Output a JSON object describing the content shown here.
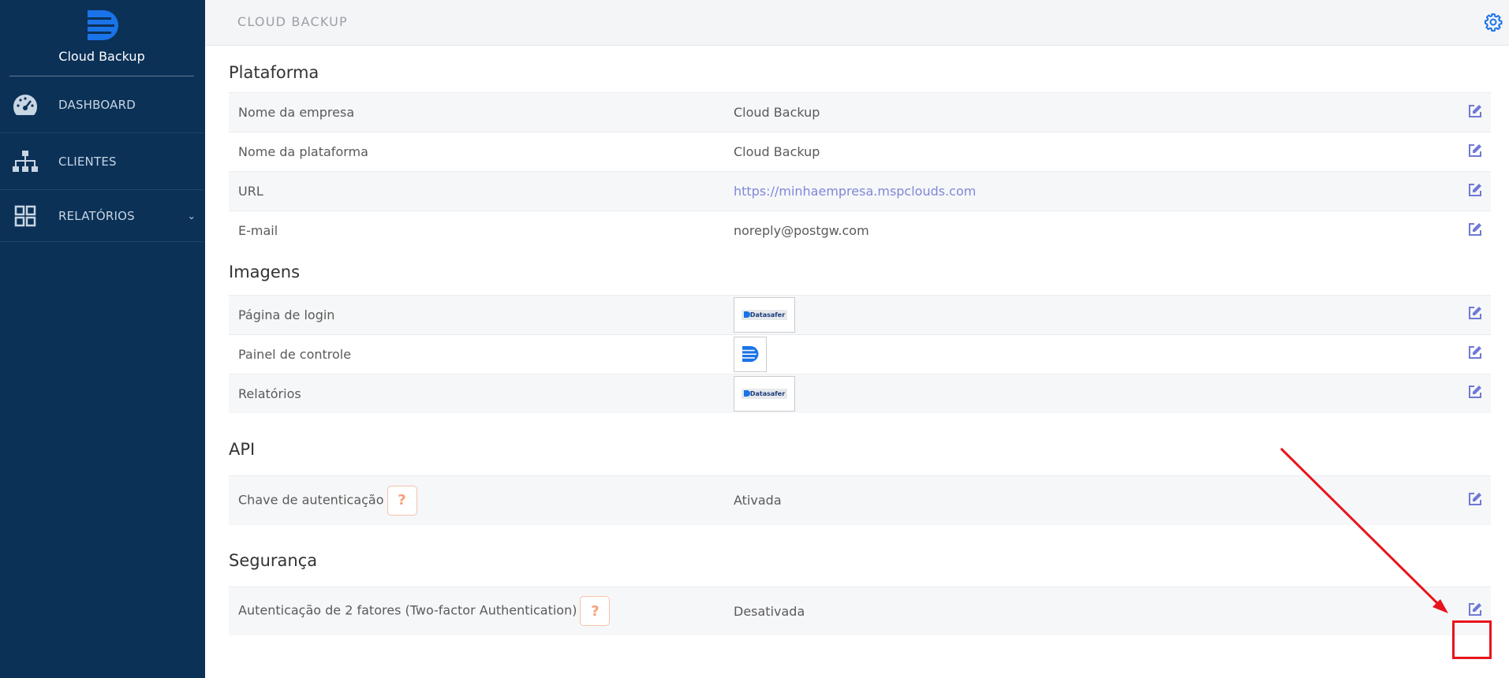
{
  "sidebar": {
    "brand_name": "Cloud Backup",
    "items": [
      {
        "label": "DASHBOARD",
        "icon": "speedometer-icon"
      },
      {
        "label": "CLIENTES",
        "icon": "sitemap-icon"
      },
      {
        "label": "RELATÓRIOS",
        "icon": "grid-icon"
      }
    ]
  },
  "topbar": {
    "title": "CLOUD BACKUP"
  },
  "sections": {
    "plataforma": {
      "title": "Plataforma",
      "rows": [
        {
          "label": "Nome da empresa",
          "value": "Cloud Backup"
        },
        {
          "label": "Nome da plataforma",
          "value": "Cloud Backup"
        },
        {
          "label": "URL",
          "value": "https://minhaempresa.mspclouds.com"
        },
        {
          "label": "E-mail",
          "value": "noreply@postgw.com"
        }
      ]
    },
    "imagens": {
      "title": "Imagens",
      "rows": [
        {
          "label": "Página de login",
          "image_text": "Datasafer"
        },
        {
          "label": "Painel de controle"
        },
        {
          "label": "Relatórios",
          "image_text": "Datasafer"
        }
      ]
    },
    "api": {
      "title": "API",
      "rows": [
        {
          "label": "Chave de autenticação",
          "help": "?",
          "value": "Ativada"
        }
      ]
    },
    "seguranca": {
      "title": "Segurança",
      "rows": [
        {
          "label": "Autenticação de 2 fatores (Two-factor Authentication)",
          "help": "?",
          "value": "Desativada"
        }
      ]
    }
  },
  "colors": {
    "sidebar_bg": "#0b3157",
    "accent": "#1a73e8",
    "link": "#7f88d8",
    "edit_icon": "#6f79d6",
    "help": "#f5a07a",
    "annotation": "#e8141c"
  }
}
